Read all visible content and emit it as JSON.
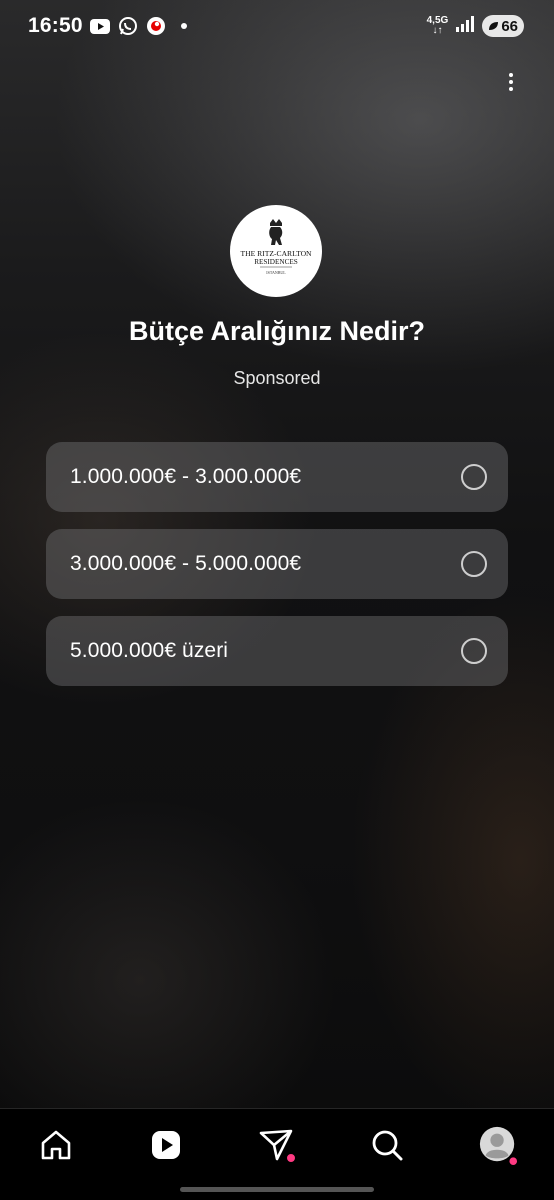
{
  "status_bar": {
    "time": "16:50",
    "network": "4,5G",
    "battery": "66",
    "icons": [
      "youtube-icon",
      "whatsapp-icon",
      "vodafone-icon",
      "notification-dot"
    ]
  },
  "header": {
    "more_icon": "more-vertical-icon"
  },
  "brand": {
    "logo_line1": "THE RITZ-CARLTON",
    "logo_line2": "RESIDENCES",
    "logo_line3": "ISTANBUL"
  },
  "poll": {
    "question": "Bütçe Aralığınız Nedir?",
    "sponsored_label": "Sponsored",
    "options": [
      {
        "label": "1.000.000€ - 3.000.000€"
      },
      {
        "label": "3.000.000€ - 5.000.000€"
      },
      {
        "label": "5.000.000€ üzeri"
      }
    ]
  },
  "bottom_nav": {
    "items": [
      "home-icon",
      "reels-icon",
      "messages-icon",
      "search-icon",
      "profile-avatar"
    ],
    "badge_color": "#ff3a82"
  },
  "colors": {
    "option_background": "#5a5a5c",
    "accent_badge": "#ff3a82"
  }
}
